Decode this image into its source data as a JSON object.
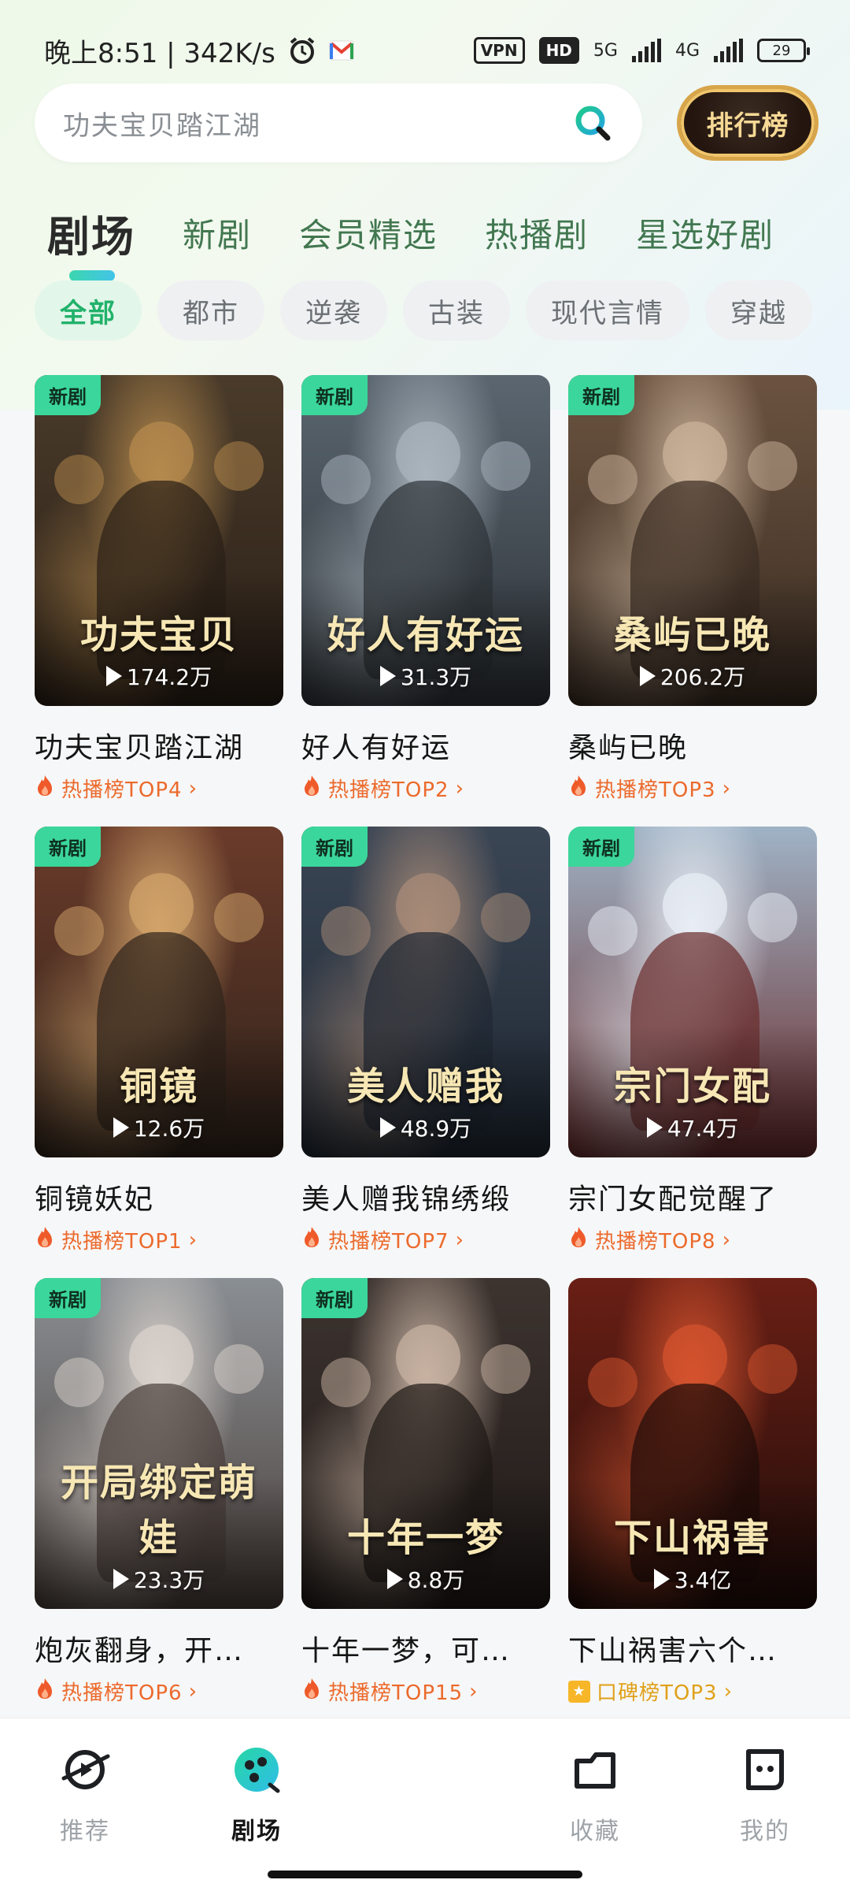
{
  "status_bar": {
    "time_speed": "晚上8:51 | 342K/s",
    "vpn": "VPN",
    "hd": "HD",
    "net1": "5G",
    "net2": "4G",
    "battery": "29"
  },
  "search": {
    "placeholder": "功夫宝贝踏江湖"
  },
  "rank_button": "排行榜",
  "tabs": [
    "剧场",
    "新剧",
    "会员精选",
    "热播剧",
    "星选好剧"
  ],
  "chips": [
    "全部",
    "都市",
    "逆袭",
    "古装",
    "现代言情",
    "穿越"
  ],
  "cards": [
    {
      "title": "功夫宝贝踏江湖",
      "art_text": "功夫宝贝",
      "plays": "174.2万",
      "rank": "热播榜TOP4",
      "badge": "新剧",
      "rank_type": "hot",
      "colors": [
        "#4a3b2a",
        "#b58a4d",
        "#2a1f17"
      ]
    },
    {
      "title": "好人有好运",
      "art_text": "好人有好运",
      "plays": "31.3万",
      "rank": "热播榜TOP2",
      "badge": "新剧",
      "rank_type": "hot",
      "colors": [
        "#5b6670",
        "#a9b4bd",
        "#2e3338"
      ]
    },
    {
      "title": "桑屿已晚",
      "art_text": "桑屿已晚",
      "plays": "206.2万",
      "rank": "热播榜TOP3",
      "badge": "新剧",
      "rank_type": "hot",
      "colors": [
        "#6b5340",
        "#c9b29a",
        "#3a2c22"
      ]
    },
    {
      "title": "铜镜妖妃",
      "art_text": "铜镜",
      "plays": "12.6万",
      "rank": "热播榜TOP1",
      "badge": "新剧",
      "rank_type": "hot",
      "colors": [
        "#6b3b2a",
        "#d2a36a",
        "#2f231b"
      ]
    },
    {
      "title": "美人赠我锦绣缎",
      "art_text": "美人赠我",
      "plays": "48.9万",
      "rank": "热播榜TOP7",
      "badge": "新剧",
      "rank_type": "hot",
      "colors": [
        "#3b4655",
        "#a88b78",
        "#1f2833"
      ]
    },
    {
      "title": "宗门女配觉醒了",
      "art_text": "宗门女配",
      "plays": "47.4万",
      "rank": "热播榜TOP8",
      "badge": "新剧",
      "rank_type": "hot",
      "colors": [
        "#9fb3c6",
        "#e8eef5",
        "#6a2c2c"
      ]
    },
    {
      "title": "炮灰翻身，开…",
      "art_text": "开局绑定萌娃",
      "plays": "23.3万",
      "rank": "热播榜TOP6",
      "badge": "新剧",
      "rank_type": "hot",
      "colors": [
        "#8a8f94",
        "#d9d2cc",
        "#4a3f3a"
      ]
    },
    {
      "title": "十年一梦，可…",
      "art_text": "十年一梦",
      "plays": "8.8万",
      "rank": "热播榜TOP15",
      "badge": "新剧",
      "rank_type": "hot",
      "colors": [
        "#3d3430",
        "#c7b2a2",
        "#1e1816"
      ]
    },
    {
      "title": "下山祸害六个…",
      "art_text": "下山祸害",
      "plays": "3.4亿",
      "rank": "口碑榜TOP3",
      "badge": "",
      "rank_type": "praise",
      "colors": [
        "#6a1f15",
        "#d4532e",
        "#1e0c09"
      ]
    }
  ],
  "nav": [
    {
      "label": "推荐",
      "icon": "planet-play-icon",
      "active": false
    },
    {
      "label": "剧场",
      "icon": "theater-icon",
      "active": true
    },
    {
      "label": "收藏",
      "icon": "folder-icon",
      "active": false
    },
    {
      "label": "我的",
      "icon": "profile-icon",
      "active": false
    }
  ],
  "accent": "#22b26a"
}
